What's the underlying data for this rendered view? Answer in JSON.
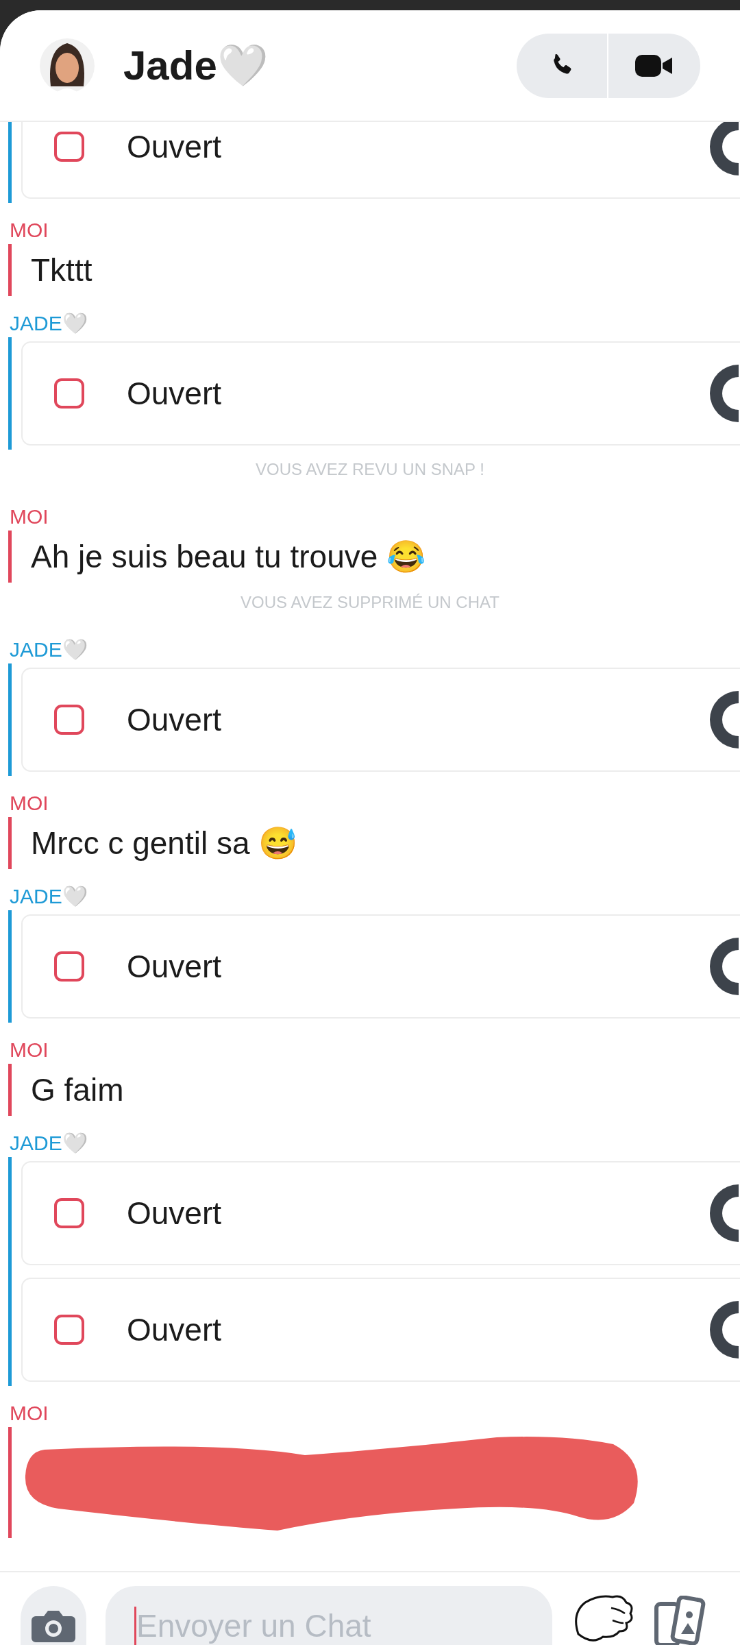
{
  "header": {
    "name": "Jade🤍"
  },
  "messages": [
    {
      "kind": "group",
      "color": "#1e9ad6",
      "items": [
        {
          "kind": "snap",
          "label": "Ouvert"
        }
      ]
    },
    {
      "kind": "group",
      "sender": "MOI",
      "color": "#e0475b",
      "items": [
        {
          "kind": "text",
          "text": "Tkttt"
        }
      ]
    },
    {
      "kind": "group",
      "sender": "JADE🤍",
      "color": "#1e9ad6",
      "items": [
        {
          "kind": "snap",
          "label": "Ouvert"
        }
      ]
    },
    {
      "kind": "notice",
      "text": "VOUS AVEZ REVU UN SNAP !"
    },
    {
      "kind": "group",
      "sender": "MOI",
      "color": "#e0475b",
      "items": [
        {
          "kind": "text",
          "text": "Ah je suis beau tu trouve 😂"
        }
      ]
    },
    {
      "kind": "notice",
      "text": "VOUS AVEZ SUPPRIMÉ UN CHAT"
    },
    {
      "kind": "group",
      "sender": "JADE🤍",
      "color": "#1e9ad6",
      "items": [
        {
          "kind": "snap",
          "label": "Ouvert"
        }
      ]
    },
    {
      "kind": "group",
      "sender": "MOI",
      "color": "#e0475b",
      "items": [
        {
          "kind": "text",
          "text": "Mrcc c gentil sa 😅"
        }
      ]
    },
    {
      "kind": "group",
      "sender": "JADE🤍",
      "color": "#1e9ad6",
      "items": [
        {
          "kind": "snap",
          "label": "Ouvert"
        }
      ]
    },
    {
      "kind": "group",
      "sender": "MOI",
      "color": "#e0475b",
      "items": [
        {
          "kind": "text",
          "text": "G faim"
        }
      ]
    },
    {
      "kind": "group",
      "sender": "JADE🤍",
      "color": "#1e9ad6",
      "items": [
        {
          "kind": "snap",
          "label": "Ouvert"
        },
        {
          "kind": "snap",
          "label": "Ouvert"
        }
      ]
    },
    {
      "kind": "group",
      "sender": "MOI",
      "color": "#e0475b",
      "items": [
        {
          "kind": "redacted"
        }
      ]
    }
  ],
  "composer": {
    "placeholder": "Envoyer un Chat"
  }
}
